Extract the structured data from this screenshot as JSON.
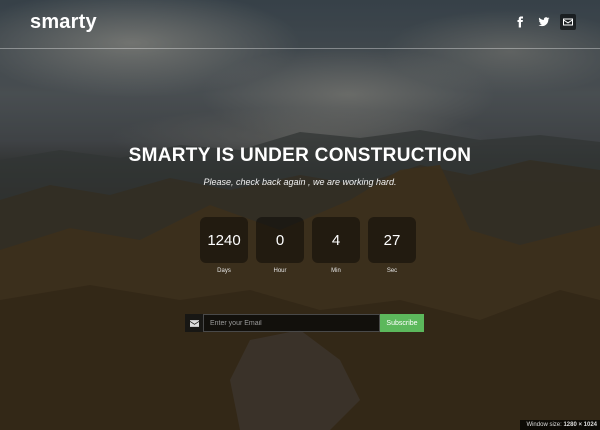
{
  "header": {
    "logo": "smarty",
    "social": [
      {
        "icon": "facebook-icon"
      },
      {
        "icon": "twitter-icon"
      },
      {
        "icon": "mail-icon"
      }
    ]
  },
  "hero": {
    "title": "SMARTY IS UNDER CONSTRUCTION",
    "subtitle": "Please, check back again , we are working hard."
  },
  "countdown": [
    {
      "value": "1240",
      "label": "Days"
    },
    {
      "value": "0",
      "label": "Hour"
    },
    {
      "value": "4",
      "label": "Min"
    },
    {
      "value": "27",
      "label": "Sec"
    }
  ],
  "subscribe": {
    "icon": "envelope-icon",
    "placeholder": "Enter your Email",
    "button_label": "Subscribe",
    "button_color": "#5cb85c"
  },
  "overlay": {
    "window_size_label": "Window size:",
    "window_size_value": "1280 × 1024"
  }
}
